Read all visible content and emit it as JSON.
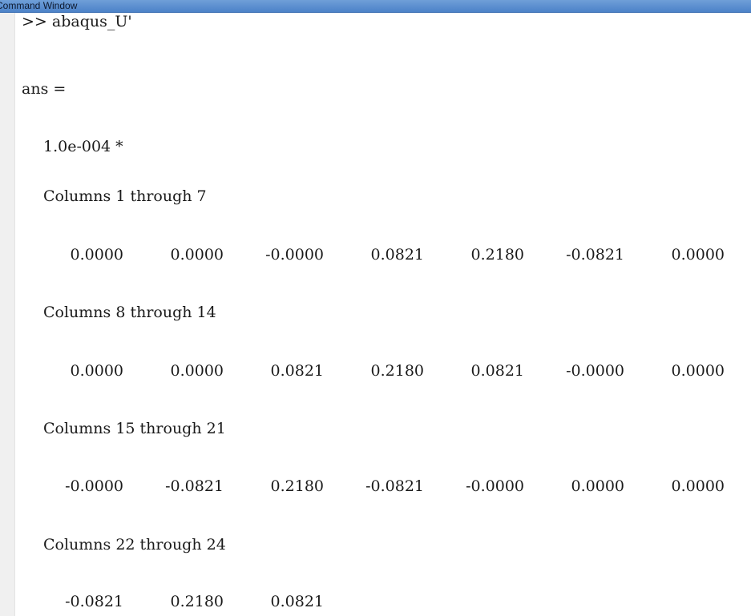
{
  "window": {
    "title": "Command Window"
  },
  "console": {
    "command": ">> abaqus_U'",
    "ans_label": "ans =",
    "scale_factor": "1.0e-004 *",
    "blocks": [
      {
        "header": "Columns 1 through 7",
        "values": [
          "0.0000",
          "0.0000",
          "-0.0000",
          "0.0821",
          "0.2180",
          "-0.0821",
          "0.0000"
        ]
      },
      {
        "header": "Columns 8 through 14",
        "values": [
          "0.0000",
          "0.0000",
          "0.0821",
          "0.2180",
          "0.0821",
          "-0.0000",
          "0.0000"
        ]
      },
      {
        "header": "Columns 15 through 21",
        "values": [
          "-0.0000",
          "-0.0821",
          "0.2180",
          "-0.0821",
          "-0.0000",
          "0.0000",
          "0.0000"
        ]
      },
      {
        "header": "Columns 22 through 24",
        "values": [
          "-0.0821",
          "0.2180",
          "0.0821"
        ]
      }
    ]
  }
}
